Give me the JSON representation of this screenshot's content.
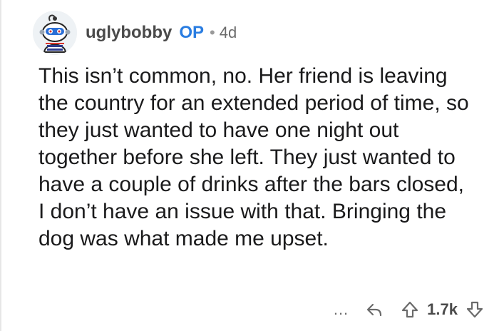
{
  "comment": {
    "username": "uglybobby",
    "op_badge": "OP",
    "separator": "•",
    "age": "4d",
    "text": "This isn’t common, no. Her friend is leaving the country for an extended period of time, so they just wanted to have one night out together before she left. They just wanted to have a couple of drinks after the bars closed, I don’t have an issue with that. Bringing the dog was what made me upset.",
    "more_label": "...",
    "vote_count": "1.7k"
  },
  "colors": {
    "op_badge": "#2a7de1",
    "text": "#1a1a1b",
    "muted": "#6b6b6b"
  },
  "icons": [
    "avatar",
    "reply-icon",
    "upvote-icon",
    "downvote-icon"
  ]
}
